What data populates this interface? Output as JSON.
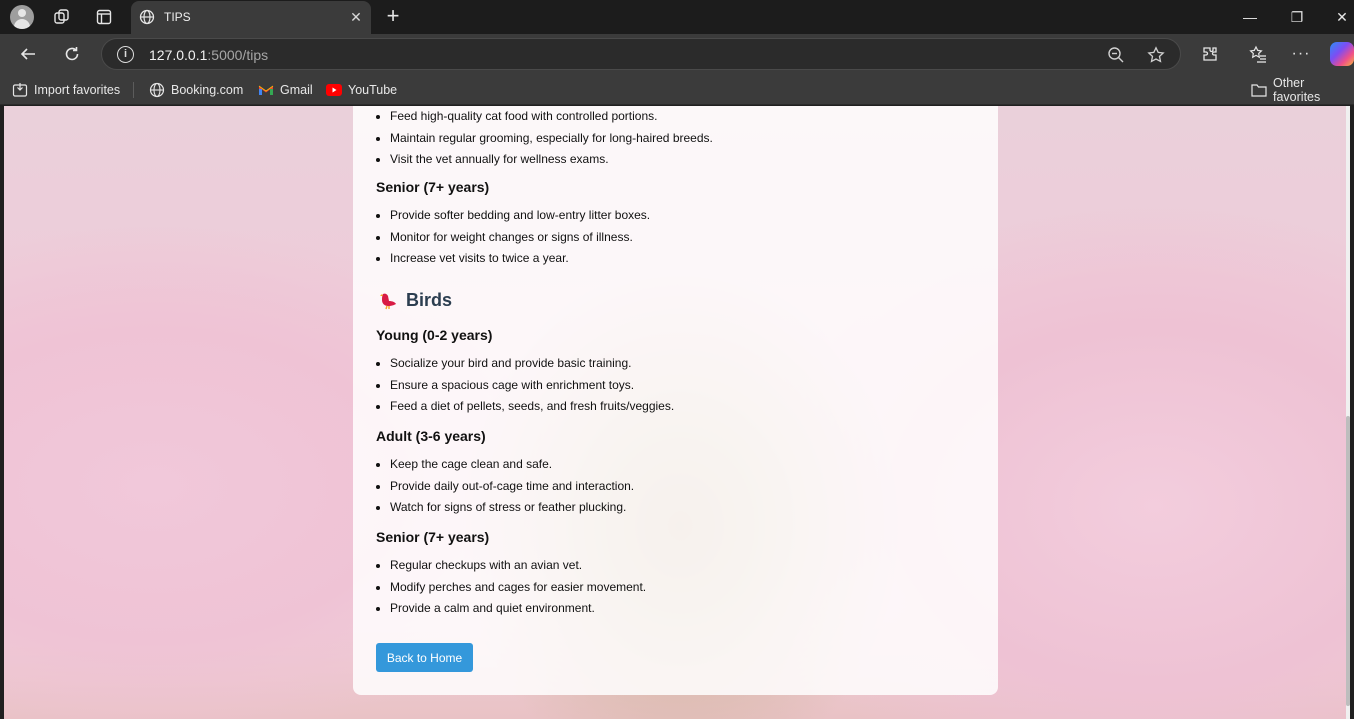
{
  "browser": {
    "tab_title": "TIPS",
    "url_host": "127.0.0.1",
    "url_path": ":5000/tips",
    "favorites": [
      {
        "label": "Import favorites",
        "icon": "import-icon"
      },
      {
        "label": "Booking.com",
        "icon": "globe-icon"
      },
      {
        "label": "Gmail",
        "icon": "gmail-icon"
      },
      {
        "label": "YouTube",
        "icon": "youtube-icon"
      }
    ],
    "other_favorites": "Other favorites"
  },
  "page": {
    "cats_adult": {
      "items": [
        "Feed high-quality cat food with controlled portions.",
        "Maintain regular grooming, especially for long-haired breeds.",
        "Visit the vet annually for wellness exams."
      ]
    },
    "cats_senior": {
      "heading": "Senior (7+ years)",
      "items": [
        "Provide softer bedding and low-entry litter boxes.",
        "Monitor for weight changes or signs of illness.",
        "Increase vet visits to twice a year."
      ]
    },
    "birds": {
      "title": "Birds",
      "icon": "bird-icon",
      "young": {
        "heading": "Young (0-2 years)",
        "items": [
          "Socialize your bird and provide basic training.",
          "Ensure a spacious cage with enrichment toys.",
          "Feed a diet of pellets, seeds, and fresh fruits/veggies."
        ]
      },
      "adult": {
        "heading": "Adult (3-6 years)",
        "items": [
          "Keep the cage clean and safe.",
          "Provide daily out-of-cage time and interaction.",
          "Watch for signs of stress or feather plucking."
        ]
      },
      "senior": {
        "heading": "Senior (7+ years)",
        "items": [
          "Regular checkups with an avian vet.",
          "Modify perches and cages for easier movement.",
          "Provide a calm and quiet environment."
        ]
      }
    },
    "back_button": "Back to Home",
    "colors": {
      "button": "#3498db",
      "heading": "#2c3e50"
    }
  }
}
